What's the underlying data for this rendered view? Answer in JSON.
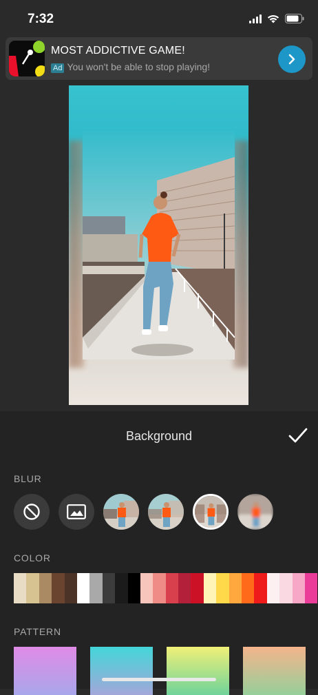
{
  "status": {
    "time": "7:32"
  },
  "ad": {
    "title": "MOST ADDICTIVE GAME!",
    "tag": "Ad",
    "subtitle": "You won't be able to stop playing!"
  },
  "panel": {
    "title": "Background",
    "blur_label": "BLUR",
    "color_label": "COLOR",
    "pattern_label": "PATTERN",
    "blur_options": [
      {
        "icon": "no-blur-icon"
      },
      {
        "icon": "image-icon"
      },
      {
        "thumb": "blur-level-1"
      },
      {
        "thumb": "blur-level-2"
      },
      {
        "thumb": "blur-level-3",
        "selected": true
      },
      {
        "thumb": "blur-level-4"
      }
    ],
    "colors": [
      "#e8dcc4",
      "#d7c391",
      "#a98a63",
      "#6b4430",
      "#4b3327",
      "#ffffff",
      "#a9a9a9",
      "#3c3c3c",
      "#1b1b1b",
      "#000000",
      "#f7c5bb",
      "#ef8c86",
      "#d9404d",
      "#b3203a",
      "#cc1026",
      "#fff3b5",
      "#ffd94a",
      "#ffa83e",
      "#ff6a1a",
      "#ef1b1b",
      "#fdf0f0",
      "#fbd9e3",
      "#f6a8c6",
      "#ea3c98"
    ],
    "patterns": [
      [
        "#e08be6",
        "#a8a6ea"
      ],
      [
        "#43d6d8",
        "#a3a7d9"
      ],
      [
        "#f0f078",
        "#6fd39a"
      ],
      [
        "#f4b48c",
        "#96cf9a"
      ]
    ]
  }
}
